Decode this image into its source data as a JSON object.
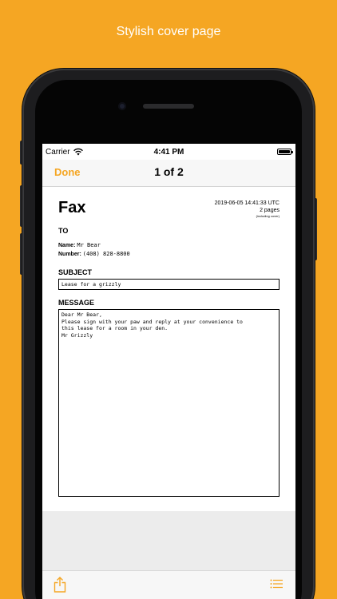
{
  "headline": "Stylish cover page",
  "status_bar": {
    "carrier": "Carrier",
    "time": "4:41 PM"
  },
  "nav": {
    "done_label": "Done",
    "title": "1 of 2"
  },
  "document": {
    "title": "Fax",
    "date": "2019-06-05 14:41:33 UTC",
    "pages": "2 pages",
    "including": "(including cover)",
    "to_label": "TO",
    "name_key": "Name:",
    "name_value": "Mr Bear",
    "number_key": "Number:",
    "number_value": "(408) 828-8800",
    "subject_label": "SUBJECT",
    "subject_value": "Lease for a grizzly",
    "message_label": "MESSAGE",
    "message_lines": [
      "Dear Mr Bear,",
      "Please sign with your paw and reply at your convenience to",
      "this lease for a room in your den.",
      "Mr Grizzly"
    ]
  },
  "colors": {
    "background": "#F5A623",
    "accent": "#F5A623"
  },
  "icons": {
    "share": "share-icon",
    "list": "list-icon",
    "wifi": "wifi-icon",
    "battery": "battery-icon"
  }
}
